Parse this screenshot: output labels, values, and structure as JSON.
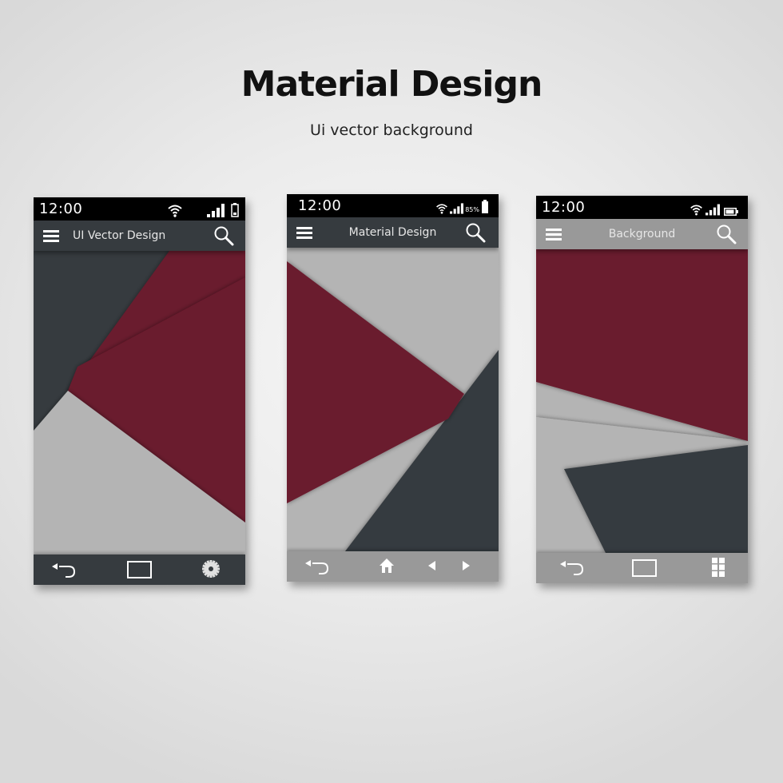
{
  "header": {
    "title": "Material Design",
    "subtitle": "Ui vector background"
  },
  "colors": {
    "dark": "#363b3f",
    "crimson": "#6b1a2d",
    "light_gray": "#b4b4b4",
    "mid_gray": "#999999",
    "status_black": "#000000"
  },
  "phones": [
    {
      "status": {
        "time": "12:00",
        "icons": [
          "wifi-icon",
          "signal-icon",
          "battery-icon"
        ]
      },
      "appbar": {
        "title": "UI Vector Design",
        "menu_icon": "hamburger-menu-icon",
        "search_icon": "search-icon"
      },
      "navbar": {
        "icons": [
          "back-icon",
          "recents-icon",
          "settings-gear-icon"
        ]
      }
    },
    {
      "status": {
        "time": "12:00",
        "battery_percent": "85%",
        "icons": [
          "wifi-icon",
          "signal-icon",
          "battery-icon"
        ]
      },
      "appbar": {
        "title": "Material Design",
        "menu_icon": "hamburger-menu-icon",
        "search_icon": "search-icon"
      },
      "navbar": {
        "icons": [
          "back-icon",
          "home-icon",
          "previous-icon",
          "next-icon"
        ]
      }
    },
    {
      "status": {
        "time": "12:00",
        "icons": [
          "wifi-icon",
          "signal-icon",
          "battery-icon"
        ]
      },
      "appbar": {
        "title": "Background",
        "menu_icon": "hamburger-menu-icon",
        "search_icon": "search-icon"
      },
      "navbar": {
        "icons": [
          "back-icon",
          "recents-icon",
          "apps-grid-icon"
        ]
      }
    }
  ]
}
